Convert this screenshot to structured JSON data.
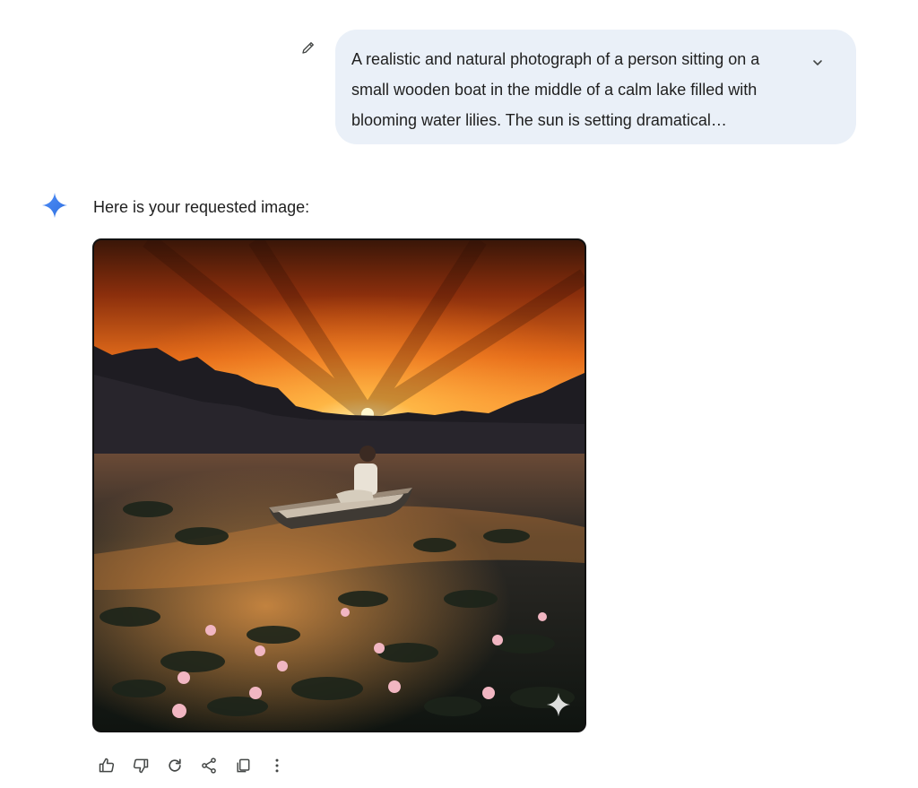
{
  "prompt": {
    "text": "A realistic and natural photograph of a person sitting on a small wooden boat in the middle of a calm lake filled with blooming water lilies. The sun is setting dramatical…",
    "edit_icon": "pencil-icon",
    "expand_icon": "chevron-down-icon"
  },
  "response": {
    "logo_icon": "gemini-sparkle-icon",
    "text": "Here is your requested image:",
    "image_description": "Generated image: person in a wooden boat on a lily-filled lake at sunset with mountains",
    "image_badge_icon": "sparkle-icon"
  },
  "actions": [
    {
      "name": "thumbs-up-icon"
    },
    {
      "name": "thumbs-down-icon"
    },
    {
      "name": "regenerate-icon"
    },
    {
      "name": "share-icon"
    },
    {
      "name": "copy-icon"
    },
    {
      "name": "more-options-icon"
    }
  ],
  "colors": {
    "bubble_bg": "#eaf0f8",
    "gemini_blue": "#4285f4",
    "icon_gray": "#444746"
  }
}
